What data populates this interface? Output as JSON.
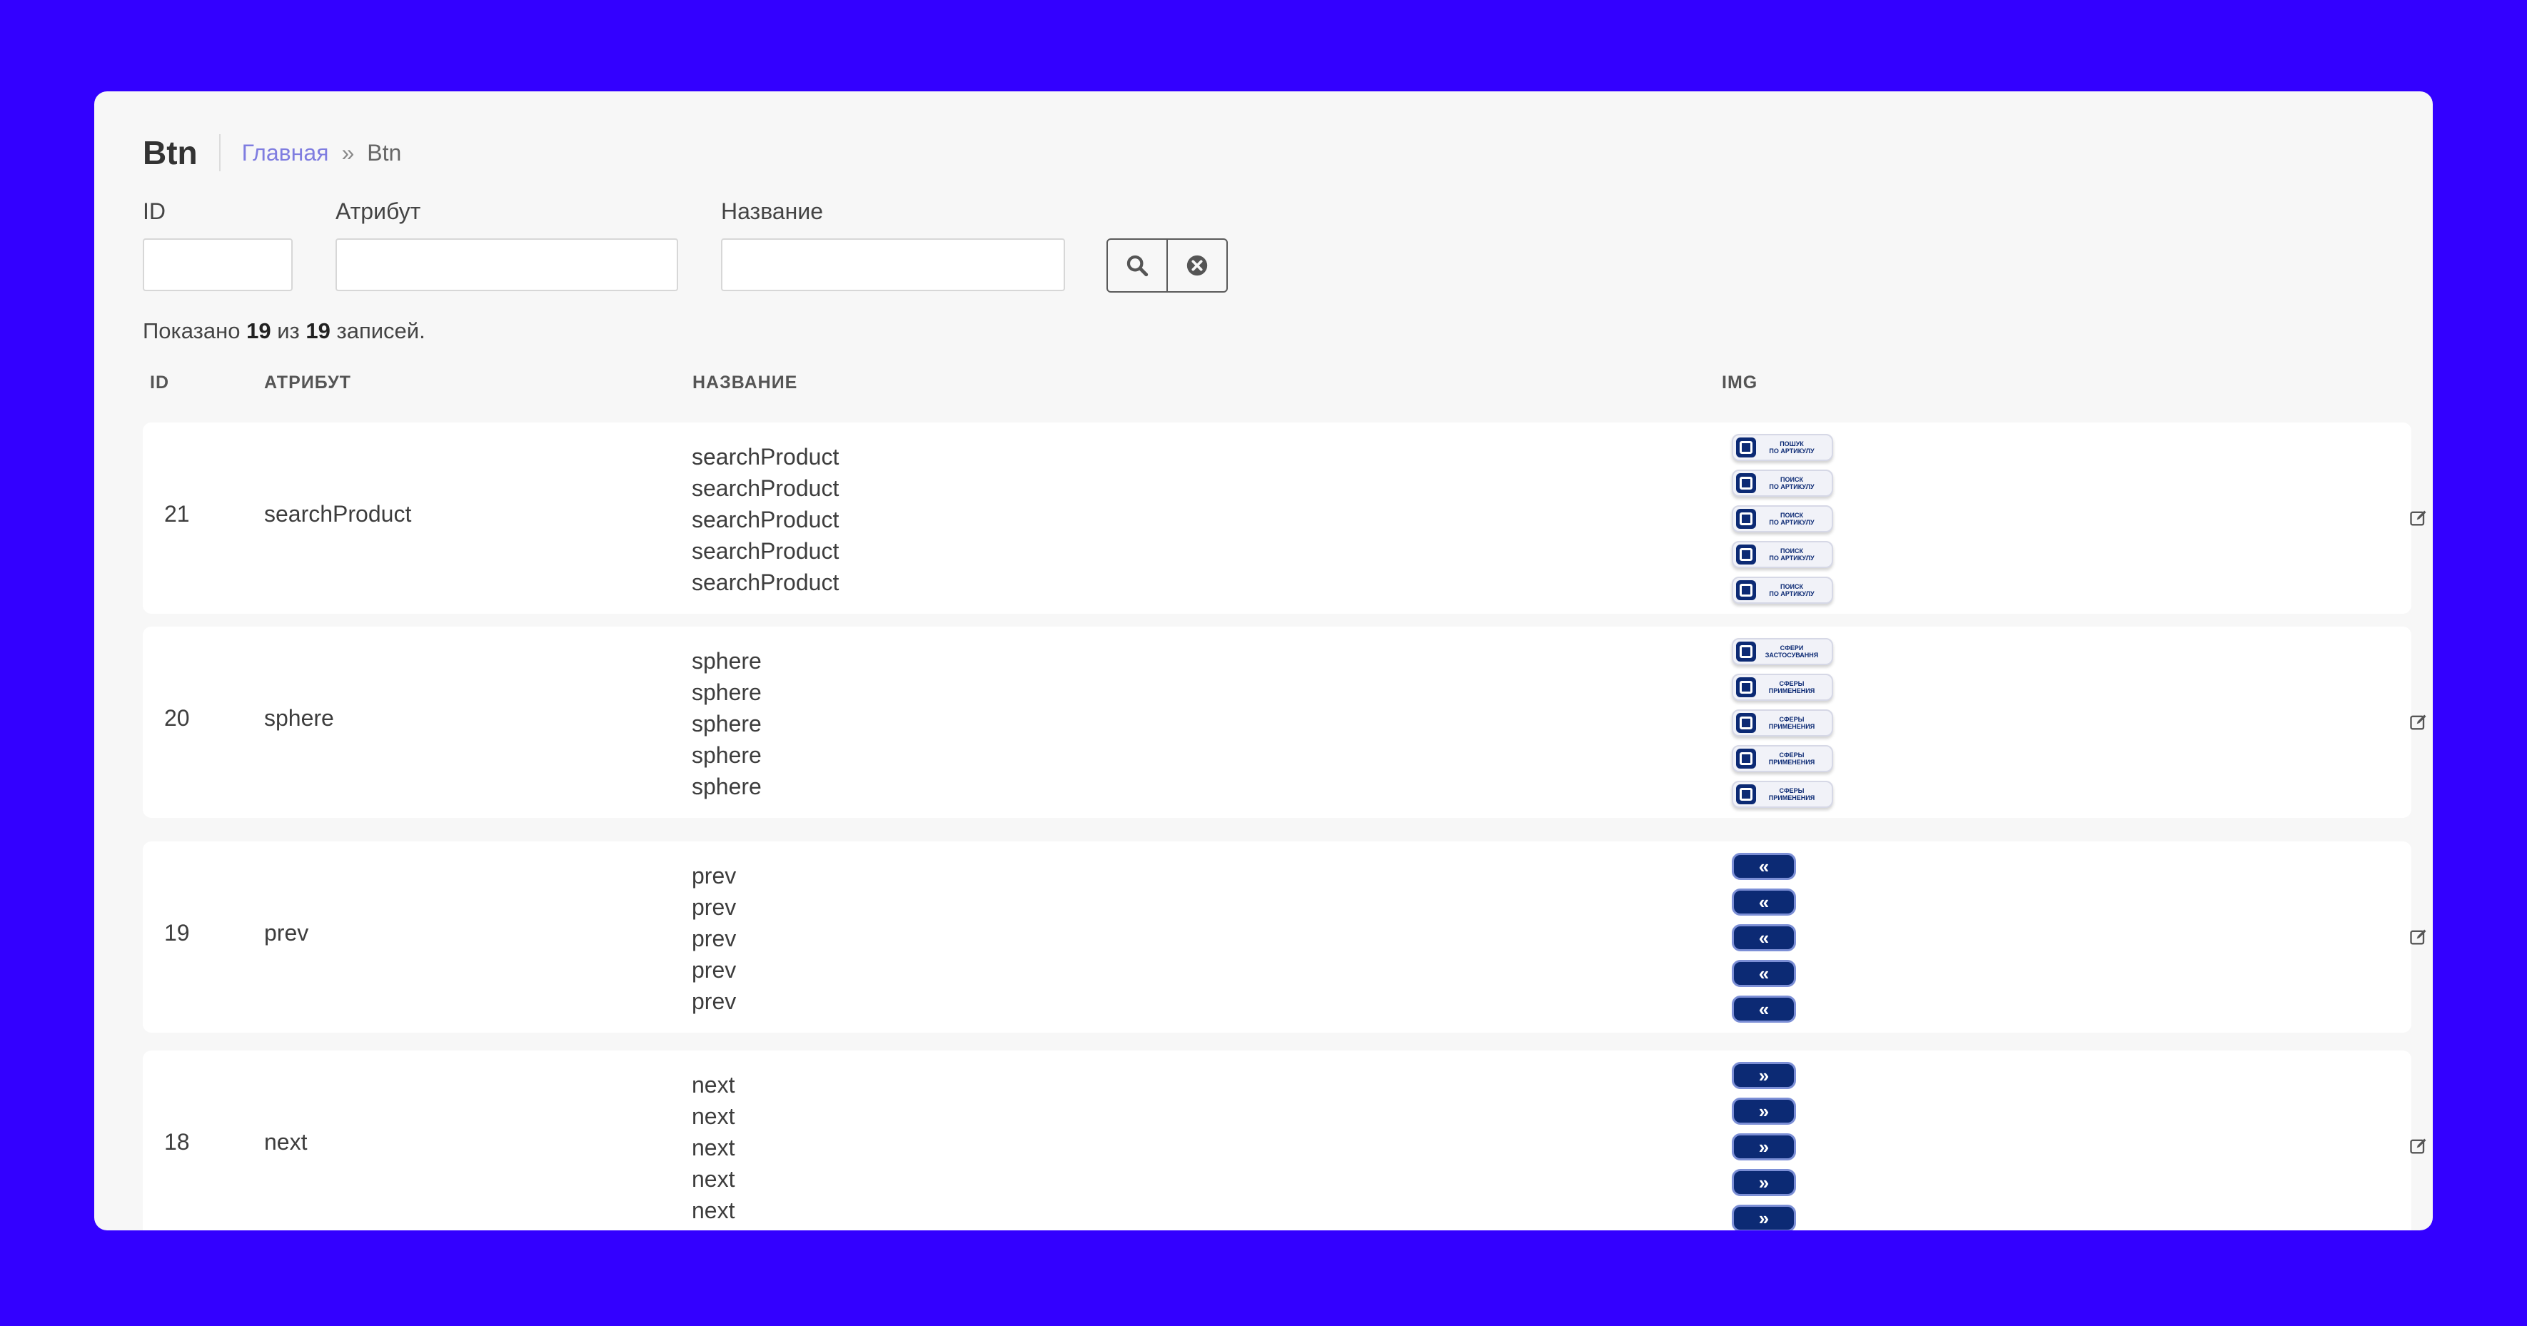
{
  "header": {
    "title": "Btn",
    "breadcrumb_home": "Главная",
    "breadcrumb_sep": "»",
    "breadcrumb_current": "Btn"
  },
  "filters": {
    "id_label": "ID",
    "attr_label": "Атрибут",
    "name_label": "Название",
    "id_value": "",
    "attr_value": "",
    "name_value": ""
  },
  "summary": {
    "prefix": "Показано",
    "shown": "19",
    "of": "из",
    "total": "19",
    "suffix": "записей."
  },
  "columns": {
    "id": "ID",
    "attr": "АТРИБУТ",
    "name": "НАЗВАНИЕ",
    "img": "IMG"
  },
  "rows": [
    {
      "id": "21",
      "attr": "searchProduct",
      "names": [
        "searchProduct",
        "searchProduct",
        "searchProduct",
        "searchProduct",
        "searchProduct"
      ],
      "img_labels": [
        "ПОШУК\nПО АРТИКУЛУ",
        "ПОИСК\nПО АРТИКУЛУ",
        "ПОИСК\nПО АРТИКУЛУ",
        "ПОИСК\nПО АРТИКУЛУ",
        "ПОИСК\nПО АРТИКУЛУ"
      ]
    },
    {
      "id": "20",
      "attr": "sphere",
      "names": [
        "sphere",
        "sphere",
        "sphere",
        "sphere",
        "sphere"
      ],
      "img_labels": [
        "СФЕРИ\nЗАСТОСУВАННЯ",
        "СФЕРЫ\nПРИМЕНЕНИЯ",
        "СФЕРЫ\nПРИМЕНЕНИЯ",
        "СФЕРЫ\nПРИМЕНЕНИЯ",
        "СФЕРЫ\nПРИМЕНЕНИЯ"
      ]
    },
    {
      "id": "19",
      "attr": "prev",
      "names": [
        "prev",
        "prev",
        "prev",
        "prev",
        "prev"
      ],
      "img_labels": [
        "«",
        "«",
        "«",
        "«",
        "«"
      ]
    },
    {
      "id": "18",
      "attr": "next",
      "names": [
        "next",
        "next",
        "next",
        "next",
        "next"
      ],
      "img_labels": [
        "»",
        "»",
        "»",
        "»",
        "»"
      ]
    }
  ],
  "icons": {
    "search": "search-icon",
    "clear": "clear-circle-icon",
    "edit": "edit-icon",
    "delete": "trash-icon"
  },
  "colors": {
    "background": "#3300ff",
    "card": "#f7f7f7",
    "link": "#7f7de0",
    "button_navy": "#0c2a74"
  }
}
